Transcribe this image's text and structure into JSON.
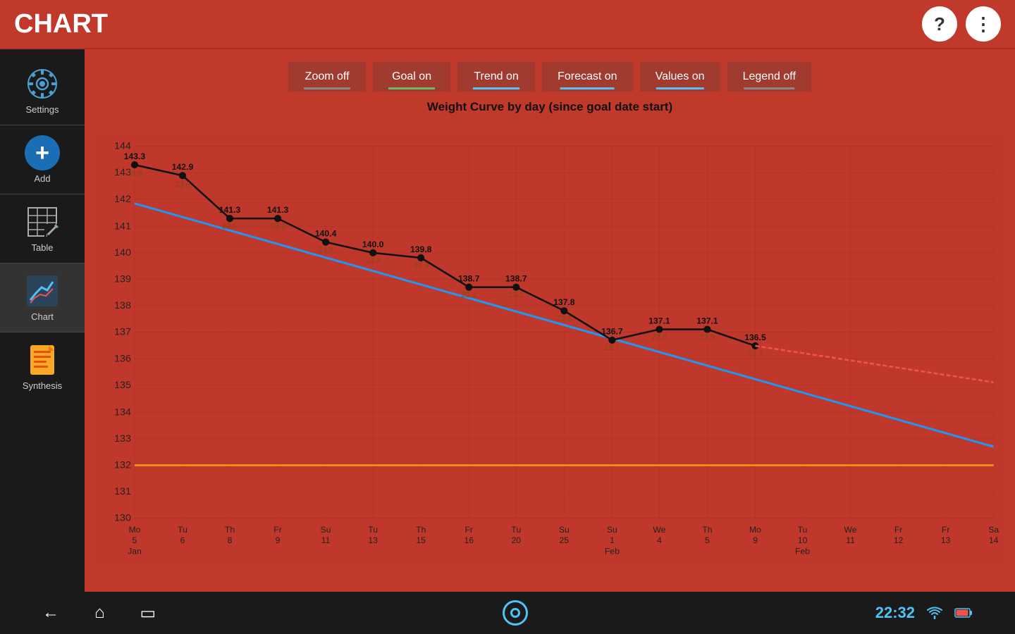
{
  "header": {
    "title": "CHART",
    "help_label": "?",
    "menu_label": "⋮"
  },
  "toggles": [
    {
      "label": "Zoom off",
      "state": "off",
      "id": "zoom"
    },
    {
      "label": "Goal on",
      "state": "on",
      "id": "goal"
    },
    {
      "label": "Trend on",
      "state": "on",
      "id": "trend"
    },
    {
      "label": "Forecast on",
      "state": "on",
      "id": "forecast"
    },
    {
      "label": "Values on",
      "state": "on",
      "id": "values"
    },
    {
      "label": "Legend off",
      "state": "off",
      "id": "legend"
    }
  ],
  "chart": {
    "title": "Weight Curve by day (since goal date start)",
    "y_min": 130,
    "y_max": 144,
    "goal_line": 132,
    "x_labels": [
      {
        "day": "Mo",
        "date": "5",
        "month": "Jan"
      },
      {
        "day": "Tu",
        "date": "6",
        "month": ""
      },
      {
        "day": "Th",
        "date": "8",
        "month": ""
      },
      {
        "day": "Fr",
        "date": "9",
        "month": ""
      },
      {
        "day": "Su",
        "date": "11",
        "month": ""
      },
      {
        "day": "Tu",
        "date": "13",
        "month": ""
      },
      {
        "day": "Th",
        "date": "15",
        "month": ""
      },
      {
        "day": "Fr",
        "date": "16",
        "month": ""
      },
      {
        "day": "Tu",
        "date": "20",
        "month": ""
      },
      {
        "day": "Su",
        "date": "25",
        "month": ""
      },
      {
        "day": "Su",
        "date": "1",
        "month": "Feb"
      },
      {
        "day": "We",
        "date": "4",
        "month": ""
      },
      {
        "day": "Th",
        "date": "5",
        "month": ""
      },
      {
        "day": "Mo",
        "date": "9",
        "month": ""
      },
      {
        "day": "Tu",
        "date": "10",
        "month": "Feb"
      },
      {
        "day": "We",
        "date": "11",
        "month": ""
      },
      {
        "day": "Fr",
        "date": "12",
        "month": ""
      },
      {
        "day": "Fr",
        "date": "13",
        "month": ""
      },
      {
        "day": "Sa",
        "date": "14",
        "month": ""
      }
    ],
    "data_points": [
      {
        "x_idx": 0,
        "weight": 143.3,
        "fat": 23.8
      },
      {
        "x_idx": 1,
        "weight": 142.9,
        "fat": 23.6
      },
      {
        "x_idx": 2,
        "weight": 141.3,
        "fat": 23.5
      },
      {
        "x_idx": 3,
        "weight": 141.3,
        "fat": 23.3
      },
      {
        "x_idx": 4,
        "weight": 140.4,
        "fat": 23.4
      },
      {
        "x_idx": 5,
        "weight": 140.0,
        "fat": 23.3
      },
      {
        "x_idx": 6,
        "weight": 139.8,
        "fat": 23.3
      },
      {
        "x_idx": 7,
        "weight": 138.7,
        "fat": 23.1
      },
      {
        "x_idx": 8,
        "weight": 138.7,
        "fat": 23.1
      },
      {
        "x_idx": 9,
        "weight": 137.8,
        "fat": 22.9
      },
      {
        "x_idx": 10,
        "weight": 136.7,
        "fat": 22.7
      },
      {
        "x_idx": 11,
        "weight": 137.1,
        "fat": 22.8
      },
      {
        "x_idx": 12,
        "weight": 137.1,
        "fat": 22.8
      },
      {
        "x_idx": 13,
        "weight": 136.5,
        "fat": 22.7
      }
    ]
  },
  "sidebar": {
    "items": [
      {
        "id": "settings",
        "label": "Settings"
      },
      {
        "id": "add",
        "label": "Add"
      },
      {
        "id": "table",
        "label": "Table"
      },
      {
        "id": "chart",
        "label": "Chart",
        "active": true
      },
      {
        "id": "synthesis",
        "label": "Synthesis"
      }
    ]
  },
  "bottom_bar": {
    "time": "22:32"
  }
}
